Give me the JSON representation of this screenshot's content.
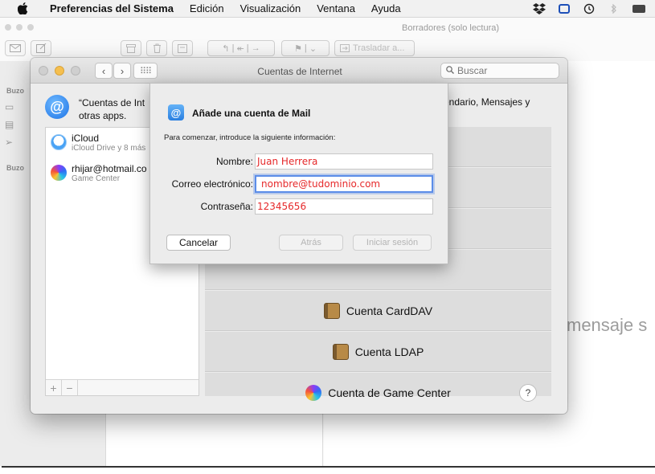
{
  "menubar": {
    "apple_icon": "apple-logo-icon",
    "items": [
      "Preferencias del Sistema",
      "Edición",
      "Visualización",
      "Ventana",
      "Ayuda"
    ],
    "status_icons": [
      "dropbox-icon",
      "screen-icon",
      "time-machine-icon",
      "bluetooth-icon",
      "battery-icon"
    ]
  },
  "mail": {
    "title": "Borradores (solo lectura)",
    "move_label": "Trasladar a...",
    "sidebar_label_1": "Buzo",
    "sidebar_label_2": "Buzo",
    "view_text": "mensaje s"
  },
  "accounts": {
    "title": "Cuentas de Internet",
    "search_placeholder": "Buscar",
    "header_line1": "“Cuentas de Int",
    "header_line2": "otras apps.",
    "header_right": "endario, Mensajes y",
    "list": [
      {
        "name": "iCloud",
        "detail": "iCloud Drive y 8 más"
      },
      {
        "name": "rhijar@hotmail.co",
        "detail": "Game Center"
      }
    ],
    "providers": [
      "Cuenta CardDAV",
      "Cuenta LDAP",
      "Cuenta de Game Center"
    ],
    "help": "?",
    "add_symbol": "+",
    "remove_symbol": "−"
  },
  "sheet": {
    "title": "Añade una cuenta de Mail",
    "subtitle": "Para comenzar, introduce la siguiente información:",
    "name_label": "Nombre:",
    "name_value": "Juan Herrera",
    "email_label": "Correo electrónico:",
    "email_value": "nombre@tudominio.com",
    "password_label": "Contraseña:",
    "password_value": "12345656",
    "cancel": "Cancelar",
    "back": "Atrás",
    "signin": "Iniciar sesión"
  },
  "colors": {
    "accent": "#1d73e6",
    "field_text": "#e6282a",
    "focus_ring": "#5b8de8"
  }
}
